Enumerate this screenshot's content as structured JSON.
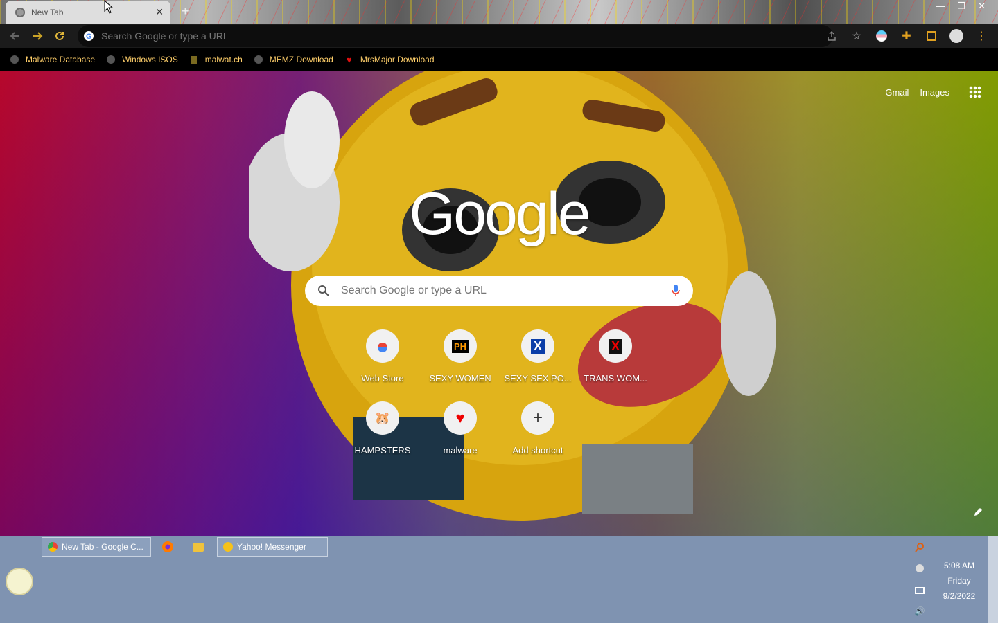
{
  "browser": {
    "tab_title": "New Tab",
    "omnibox_placeholder": "Search Google or type a URL"
  },
  "bookmarks": [
    {
      "label": "Malware Database",
      "icon": "globe-icon"
    },
    {
      "label": "Windows ISOS",
      "icon": "globe-icon"
    },
    {
      "label": "malwat.ch",
      "icon": "figure-icon"
    },
    {
      "label": "MEMZ Download",
      "icon": "globe-icon"
    },
    {
      "label": "MrsMajor Download",
      "icon": "heart-icon"
    }
  ],
  "ntp": {
    "gmail": "Gmail",
    "images": "Images",
    "logo": "Google",
    "search_placeholder": "Search Google or type a URL",
    "shortcuts": [
      {
        "label": "Web Store",
        "icon": "webstore-icon"
      },
      {
        "label": "SEXY WOMEN",
        "icon": "ph-icon"
      },
      {
        "label": "SEXY SEX PO...",
        "icon": "x-blue-icon"
      },
      {
        "label": "TRANS WOM...",
        "icon": "x-red-icon"
      },
      {
        "label": "HAMPSTERS",
        "icon": "hamster-icon"
      },
      {
        "label": "malware",
        "icon": "heart-icon"
      },
      {
        "label": "Add shortcut",
        "icon": "plus-icon"
      }
    ]
  },
  "taskbar": {
    "items": [
      {
        "label": "New Tab - Google C..."
      },
      {
        "label": ""
      },
      {
        "label": ""
      },
      {
        "label": "Yahoo! Messenger"
      }
    ],
    "clock": {
      "time": "5:08 AM",
      "day": "Friday",
      "date": "9/2/2022"
    }
  },
  "colors": {
    "bookmark_text": "#ffcf6a",
    "taskbar": "#7f93b1"
  }
}
